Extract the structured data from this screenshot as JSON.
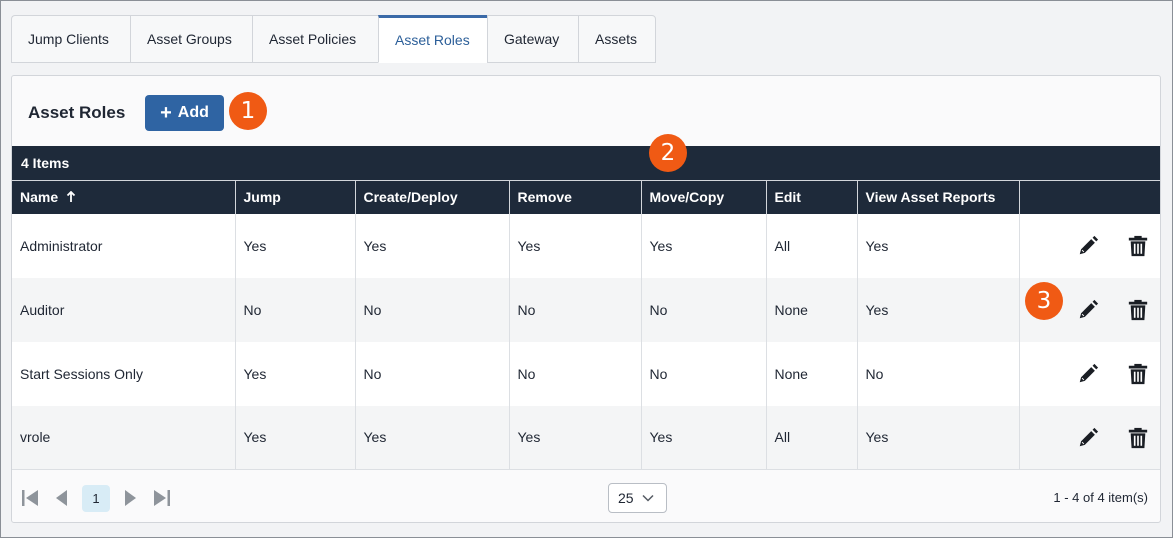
{
  "tabs": [
    {
      "label": "Jump Clients",
      "active": false
    },
    {
      "label": "Asset Groups",
      "active": false
    },
    {
      "label": "Asset Policies",
      "active": false
    },
    {
      "label": "Asset Roles",
      "active": true
    },
    {
      "label": "Gateway",
      "active": false
    },
    {
      "label": "Assets",
      "active": false
    }
  ],
  "panel": {
    "title": "Asset Roles",
    "add_label": "Add",
    "add_icon": "plus-icon"
  },
  "callouts": [
    "1",
    "2",
    "3"
  ],
  "table": {
    "count_label": "4 Items",
    "sort_icon": "arrow-up-icon",
    "columns": [
      "Name",
      "Jump",
      "Create/Deploy",
      "Remove",
      "Move/Copy",
      "Edit",
      "View Asset Reports",
      ""
    ],
    "rows": [
      [
        "Administrator",
        "Yes",
        "Yes",
        "Yes",
        "Yes",
        "All",
        "Yes"
      ],
      [
        "Auditor",
        "No",
        "No",
        "No",
        "No",
        "None",
        "Yes"
      ],
      [
        "Start Sessions Only",
        "Yes",
        "No",
        "No",
        "No",
        "None",
        "No"
      ],
      [
        "vrole",
        "Yes",
        "Yes",
        "Yes",
        "Yes",
        "All",
        "Yes"
      ]
    ],
    "row_actions": [
      "pencil-icon",
      "trash-icon"
    ]
  },
  "pager": {
    "current_page": "1",
    "page_size": "25",
    "range_text": "1 - 4 of 4 item(s)"
  },
  "colors": {
    "accent": "#2f64a3",
    "header_bg": "#1e2a3a",
    "callout": "#f05a14"
  }
}
